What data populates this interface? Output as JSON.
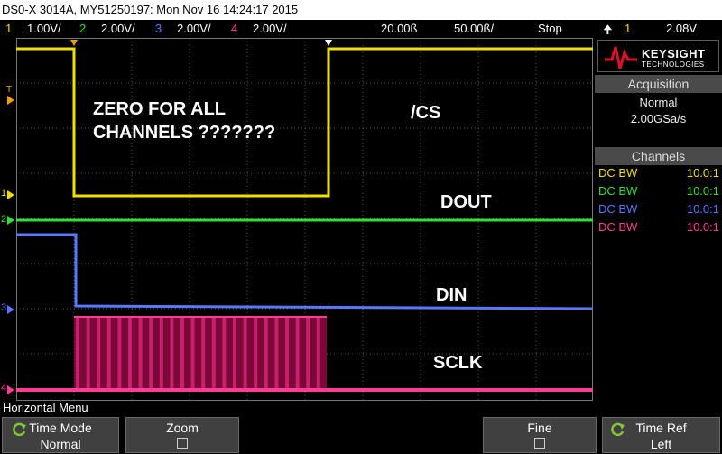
{
  "title": "DS0-X 3014A, MY51250197: Mon Nov 16 14:24:17 2015",
  "status": {
    "ch1_num": "1",
    "ch1_scale": "1.00V/",
    "ch2_num": "2",
    "ch2_scale": "2.00V/",
    "ch3_num": "3",
    "ch3_scale": "2.00V/",
    "ch4_num": "4",
    "ch4_scale": "2.00V/",
    "timebase": "20.00ß",
    "delay": "50.00ß/",
    "run_state": "Stop",
    "trigger_source": "1",
    "trigger_level": "2.08V"
  },
  "brand": {
    "name": "KEYSIGHT",
    "sub": "TECHNOLOGIES"
  },
  "acquisition": {
    "header": "Acquisition",
    "mode": "Normal",
    "rate": "2.00GSa/s"
  },
  "channels_panel": {
    "header": "Channels",
    "rows": [
      {
        "coupling": "DC BW",
        "probe": "10.0:1",
        "color": "#f0e000"
      },
      {
        "coupling": "DC BW",
        "probe": "10.0:1",
        "color": "#30e030"
      },
      {
        "coupling": "DC BW",
        "probe": "10.0:1",
        "color": "#5a78ff"
      },
      {
        "coupling": "DC BW",
        "probe": "10.0:1",
        "color": "#ff3c96"
      }
    ]
  },
  "markers": {
    "trigger": "T",
    "ch1": "1",
    "ch2": "2",
    "ch3": "3",
    "ch4": "4"
  },
  "annotations": {
    "zero_note": "ZERO FOR ALL\nCHANNELS ???????",
    "cs": "/CS",
    "dout": "DOUT",
    "din": "DIN",
    "sclk": "SCLK"
  },
  "menu": {
    "title": "Horizontal Menu"
  },
  "softkeys": {
    "time_mode": {
      "title": "Time Mode",
      "value": "Normal"
    },
    "zoom": {
      "title": "Zoom"
    },
    "fine": {
      "title": "Fine"
    },
    "time_ref": {
      "title": "Time Ref",
      "value": "Left"
    }
  },
  "colors": {
    "ch1": "#f0e000",
    "ch2": "#30e030",
    "ch3": "#5a78ff",
    "ch4": "#ff3c96",
    "trigger": "#f0a000"
  }
}
